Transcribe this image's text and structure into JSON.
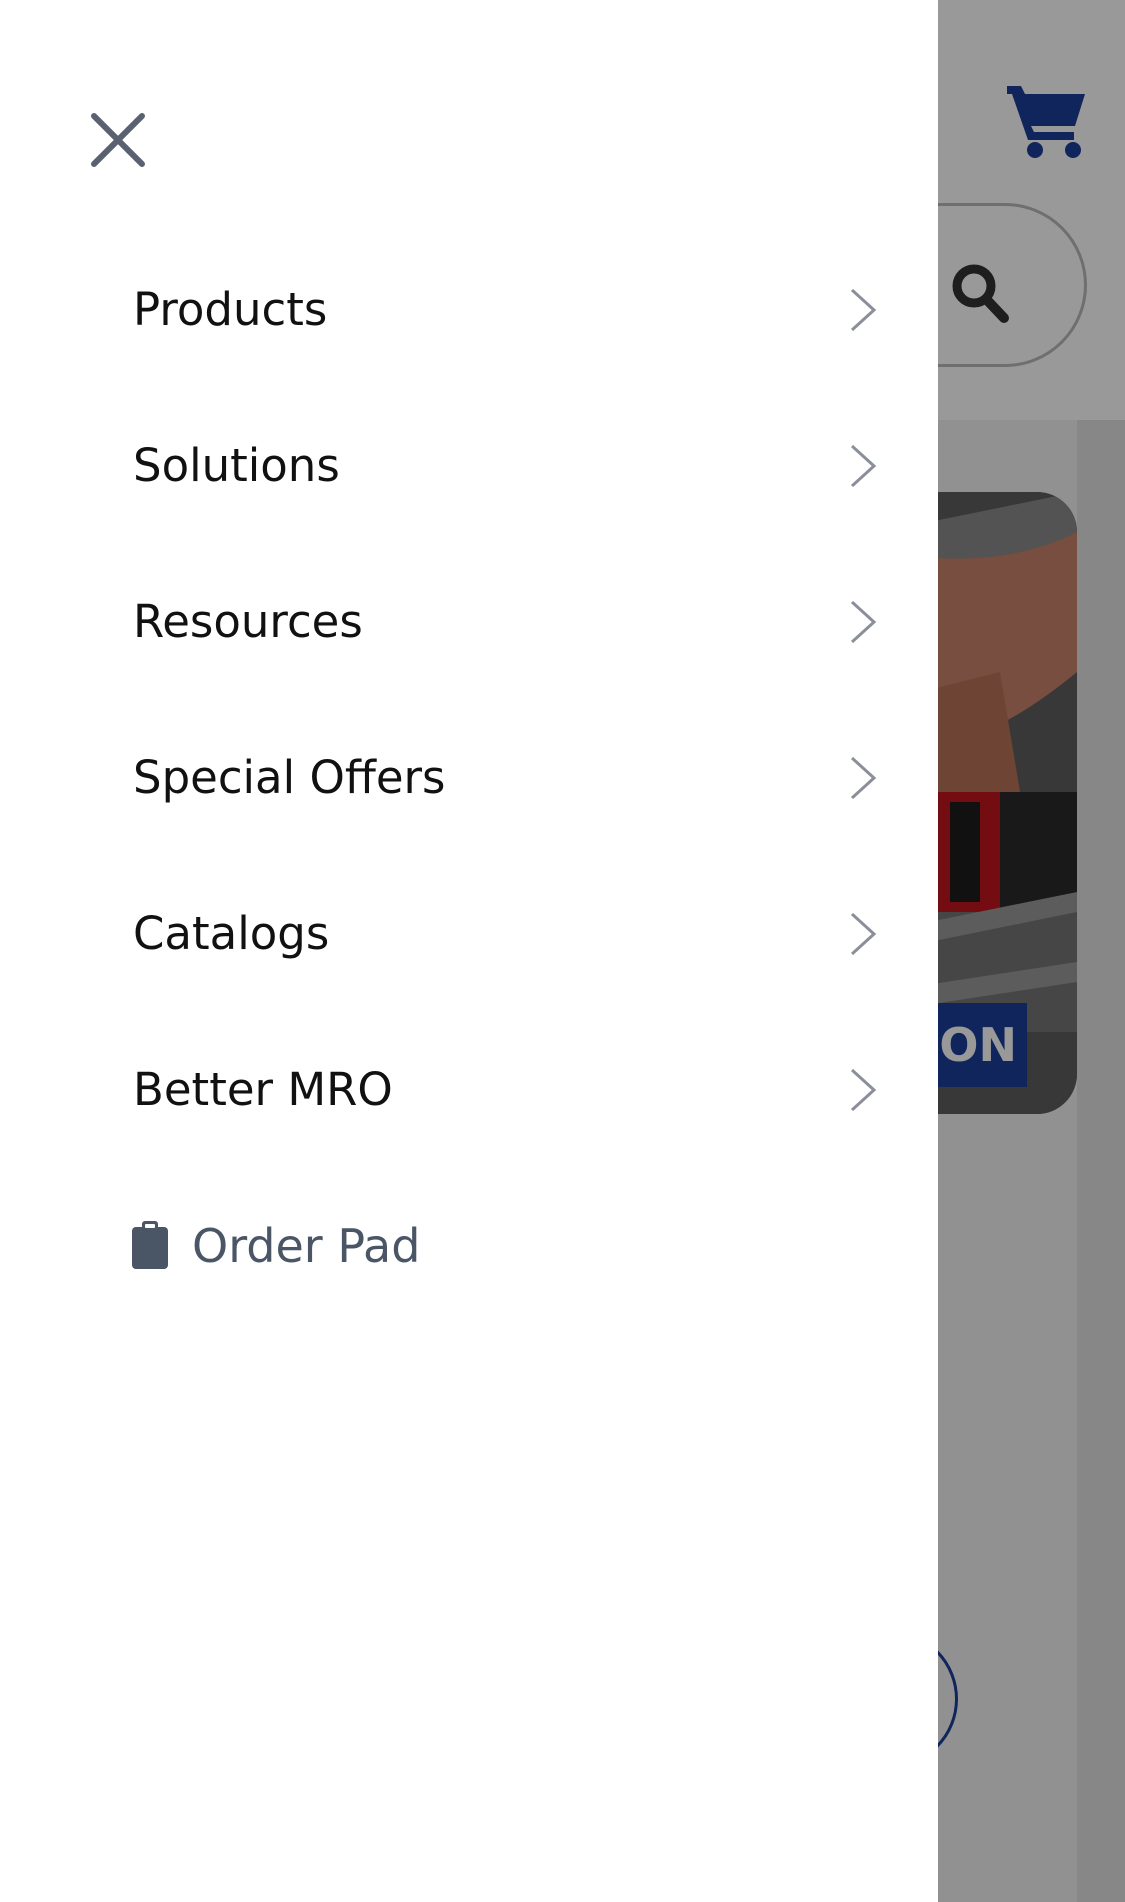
{
  "background_page": {
    "hero_badge_text": "ON",
    "colors": {
      "brand_blue": "#1b3e9a",
      "overlay": "rgba(0,0,0,0.40)"
    },
    "icons": [
      "cart-icon",
      "search-icon"
    ]
  },
  "drawer": {
    "close_icon": "close-icon",
    "nav_items": [
      {
        "label": "Products",
        "icon": "chevron-right-icon"
      },
      {
        "label": "Solutions",
        "icon": "chevron-right-icon"
      },
      {
        "label": "Resources",
        "icon": "chevron-right-icon"
      },
      {
        "label": "Special Offers",
        "icon": "chevron-right-icon"
      },
      {
        "label": "Catalogs",
        "icon": "chevron-right-icon"
      },
      {
        "label": "Better MRO",
        "icon": "chevron-right-icon"
      }
    ],
    "order_pad": {
      "label": "Order Pad",
      "icon": "clipboard-icon"
    },
    "colors": {
      "text": "#111111",
      "order_pad_text": "#4a5566",
      "chevron": "#8a8f99",
      "close_icon": "#5a6272"
    }
  }
}
